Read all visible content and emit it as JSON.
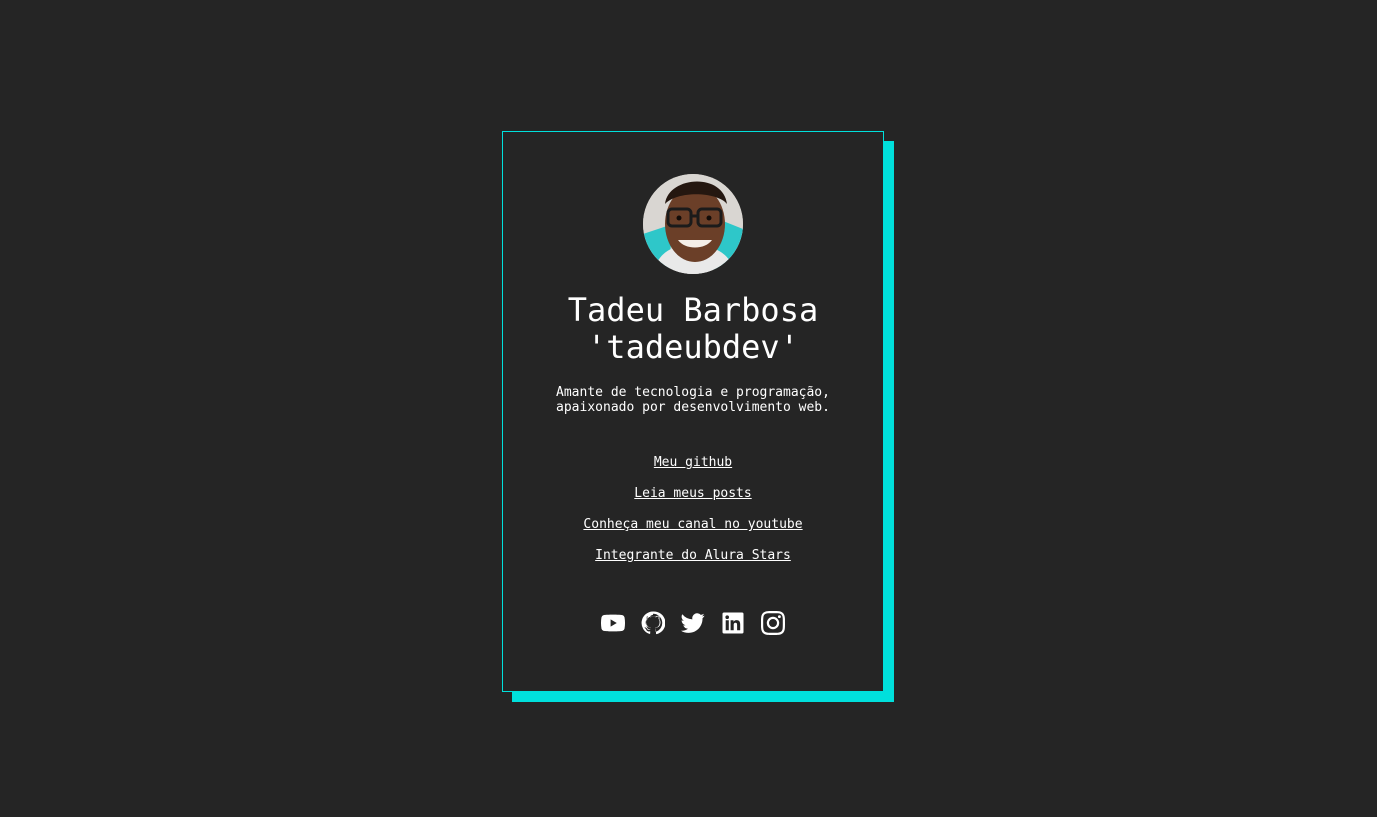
{
  "profile": {
    "name": "Tadeu Barbosa",
    "handle": "'tadeubdev'",
    "bio": "Amante de tecnologia e programação,\napaixonado por desenvolvimento web.",
    "avatar_icon": "profile-photo"
  },
  "links": [
    {
      "label": "Meu github"
    },
    {
      "label": "Leia meus posts"
    },
    {
      "label": "Conheça meu canal no youtube"
    },
    {
      "label": "Integrante do Alura Stars"
    }
  ],
  "social": [
    "youtube-icon",
    "github-icon",
    "twitter-icon",
    "linkedin-icon",
    "instagram-icon"
  ],
  "colors": {
    "background": "#252525",
    "accent": "#00e0dc",
    "text": "#ffffff"
  }
}
